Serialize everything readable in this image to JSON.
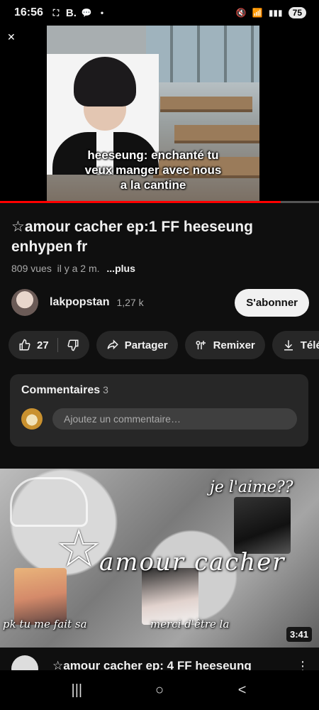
{
  "status_bar": {
    "time": "16:56",
    "battery": "75",
    "indicator_b": "B."
  },
  "player": {
    "caption_lines": [
      "heeseung: enchanté tu",
      "veux manger avec nous",
      "a la cantine"
    ],
    "progress": 0.88
  },
  "video": {
    "title": "☆amour cacher ep:1 FF heeseung enhypen fr",
    "views": "809 vues",
    "age": "il y a 2 m.",
    "more": "...plus"
  },
  "channel": {
    "name": "lakpopstan",
    "subscribers": "1,27 k",
    "subscribe_label": "S'abonner"
  },
  "actions": {
    "likes": "27",
    "share": "Partager",
    "remix": "Remixer",
    "download": "Télé"
  },
  "comments": {
    "header": "Commentaires",
    "count": "3",
    "placeholder": "Ajoutez un commentaire…"
  },
  "next_video": {
    "thumb_title": "amour cacher",
    "thumb_top_text": "je l'aime??",
    "thumb_bottom_left": "pk tu me fait sa",
    "thumb_bottom_right": "merci d'être la",
    "duration": "3:41",
    "title": "☆amour cacher ep: 4 FF heeseung"
  },
  "nav": {
    "recents": "|||",
    "home": "○",
    "back": "<"
  },
  "icons": [
    "collapse-icon",
    "like-icon",
    "dislike-icon",
    "share-icon",
    "remix-icon",
    "download-icon"
  ]
}
